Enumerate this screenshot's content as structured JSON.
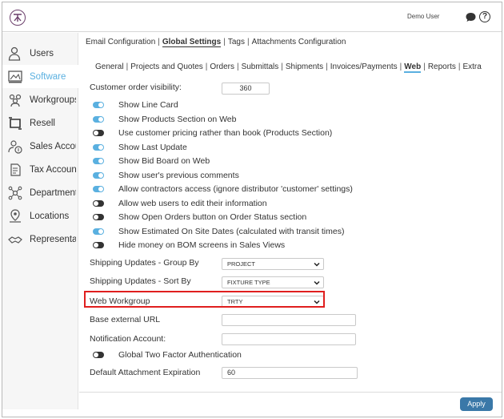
{
  "header": {
    "user_name": "Demo User"
  },
  "sidebar": {
    "items": [
      {
        "label": "Users",
        "icon": "user-icon"
      },
      {
        "label": "Software",
        "icon": "software-icon",
        "active": true
      },
      {
        "label": "Workgroups",
        "icon": "workgroups-icon"
      },
      {
        "label": "Resell",
        "icon": "resell-icon"
      },
      {
        "label": "Sales Accounts",
        "icon": "sales-accounts-icon"
      },
      {
        "label": "Tax Accounts",
        "icon": "tax-accounts-icon"
      },
      {
        "label": "Departments",
        "icon": "departments-icon"
      },
      {
        "label": "Locations",
        "icon": "locations-icon"
      },
      {
        "label": "Representatives",
        "icon": "representatives-icon"
      }
    ]
  },
  "top_tabs": [
    {
      "label": "Email Configuration"
    },
    {
      "label": "Global Settings",
      "active": true
    },
    {
      "label": "Tags"
    },
    {
      "label": "Attachments Configuration"
    }
  ],
  "sub_tabs": [
    {
      "label": "General"
    },
    {
      "label": "Projects and Quotes"
    },
    {
      "label": "Orders"
    },
    {
      "label": "Submittals"
    },
    {
      "label": "Shipments"
    },
    {
      "label": "Invoices/Payments"
    },
    {
      "label": "Web",
      "active": true
    },
    {
      "label": "Reports"
    },
    {
      "label": "Extra"
    }
  ],
  "form": {
    "customer_order_visibility": {
      "label": "Customer order visibility:",
      "value": "360"
    },
    "toggles": [
      {
        "label": "Show Line Card",
        "on": true
      },
      {
        "label": "Show Products Section on Web",
        "on": true
      },
      {
        "label": "Use customer pricing rather than book (Products Section)",
        "on": false
      },
      {
        "label": "Show Last Update",
        "on": true
      },
      {
        "label": "Show Bid Board on Web",
        "on": true
      },
      {
        "label": "Show user's previous comments",
        "on": true
      },
      {
        "label": "Allow contractors access (ignore distributor 'customer' settings)",
        "on": true
      },
      {
        "label": "Allow web users to edit their information",
        "on": false
      },
      {
        "label": "Show Open Orders button on Order Status section",
        "on": false
      },
      {
        "label": "Show Estimated On Site Dates (calculated with transit times)",
        "on": true
      },
      {
        "label": "Hide money on BOM screens in Sales Views",
        "on": false
      }
    ],
    "shipping_group_by": {
      "label": "Shipping Updates - Group By",
      "value": "PROJECT"
    },
    "shipping_sort_by": {
      "label": "Shipping Updates - Sort By",
      "value": "FIXTURE TYPE"
    },
    "web_workgroup": {
      "label": "Web Workgroup",
      "value": "TRTY"
    },
    "base_external_url": {
      "label": "Base external URL",
      "value": ""
    },
    "notification_account": {
      "label": "Notification Account:",
      "value": ""
    },
    "two_factor": {
      "label": "Global Two Factor Authentication",
      "on": false
    },
    "default_attachment_expiration": {
      "label": "Default Attachment Expiration",
      "value": "60"
    }
  },
  "footer": {
    "apply_label": "Apply"
  },
  "colors": {
    "accent": "#5ab0e0",
    "apply_button": "#3a78a8",
    "highlight": "#e01f1f"
  }
}
